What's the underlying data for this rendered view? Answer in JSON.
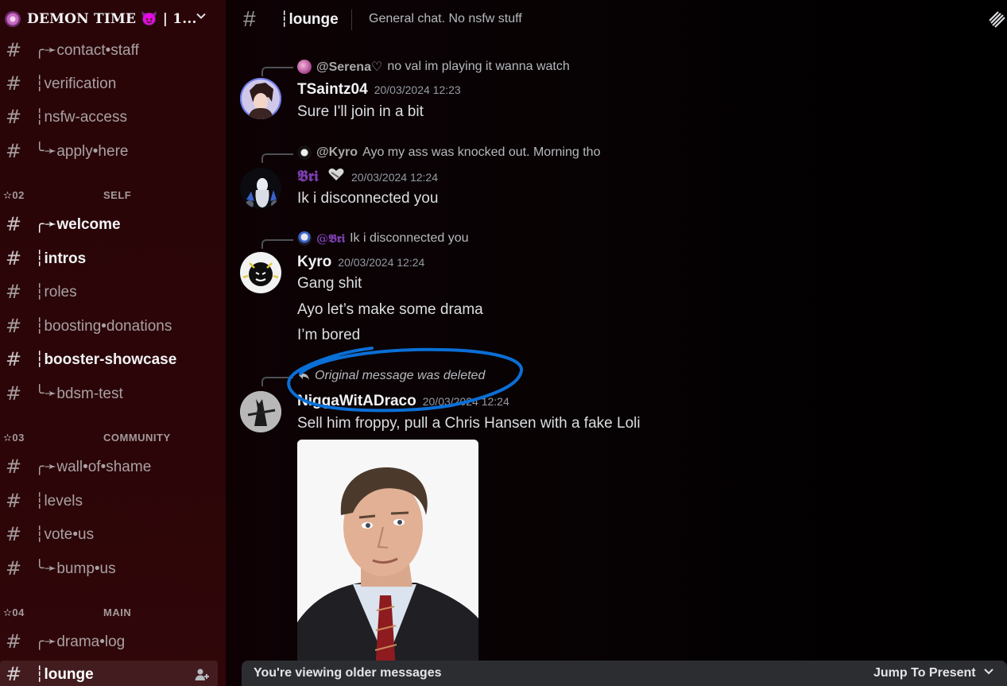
{
  "server": {
    "name": "DEMON TIME 😈 | 1...",
    "icon": "server-icon",
    "menu_icon": "chevron-down-icon"
  },
  "sidebar": {
    "channels_top": [
      {
        "label": "╭➛contact•staff"
      },
      {
        "label": "┆verification"
      },
      {
        "label": "┆nsfw-access"
      },
      {
        "label": "╰➛apply•here"
      }
    ],
    "categories": [
      {
        "number": "✫02",
        "title": "SELF",
        "channels": [
          {
            "label": "╭➛welcome",
            "bright": true
          },
          {
            "label": "┆intros",
            "bright": true
          },
          {
            "label": "┆roles",
            "bright": false
          },
          {
            "label": "┆boosting•donations",
            "bright": false
          },
          {
            "label": "┆booster-showcase",
            "bright": true
          },
          {
            "label": "╰➛bdsm-test",
            "bright": false
          }
        ]
      },
      {
        "number": "✫03",
        "title": "COMMUNITY",
        "channels": [
          {
            "label": "╭➛wall•of•shame",
            "bright": false
          },
          {
            "label": "┆levels",
            "bright": false
          },
          {
            "label": "┆vote•us",
            "bright": false
          },
          {
            "label": "╰➛bump•us",
            "bright": false
          }
        ]
      },
      {
        "number": "✫04",
        "title": "MAIN",
        "channels": [
          {
            "label": "╭➛drama•log",
            "bright": false
          },
          {
            "label": "┆lounge",
            "bright": true,
            "active": true
          }
        ]
      }
    ]
  },
  "topbar": {
    "channel": "┆lounge",
    "topic": "General chat. No nsfw stuff",
    "threads_icon": "threads-icon"
  },
  "messages": [
    {
      "reply_user": "@Serena♡",
      "reply_text": "no val im playing it wanna watch",
      "author": "TSaintz04",
      "timestamp": "20/03/2024 12:23",
      "lines": [
        "Sure I'll join in a bit"
      ]
    },
    {
      "reply_user": "@Kyro",
      "reply_text": "Ayo my ass was knocked out. Morning tho",
      "author": "𝕭𝖗𝖎",
      "timestamp": "20/03/2024 12:24",
      "lines": [
        "Ik i disconnected you"
      ]
    },
    {
      "reply_user": "@𝕭𝖗𝖎",
      "reply_text": "Ik i disconnected you",
      "author": "Kyro",
      "timestamp": "20/03/2024 12:24",
      "lines": [
        "Gang shit",
        "Ayo let’s make some drama",
        "I’m bored"
      ]
    },
    {
      "reply_deleted": "Original message was deleted",
      "author": "NiggaWitADraco",
      "timestamp": "20/03/2024 12:24",
      "lines": [
        "Sell him froppy, pull a Chris Hansen with a fake Loli"
      ]
    }
  ],
  "bottom_bar": {
    "older": "You're viewing older messages",
    "jump": "Jump To Present"
  },
  "colors": {
    "annotation": "#0a6fd6",
    "sidebar_bg": "#2a0508",
    "bri_name": "#7a3fb0"
  }
}
